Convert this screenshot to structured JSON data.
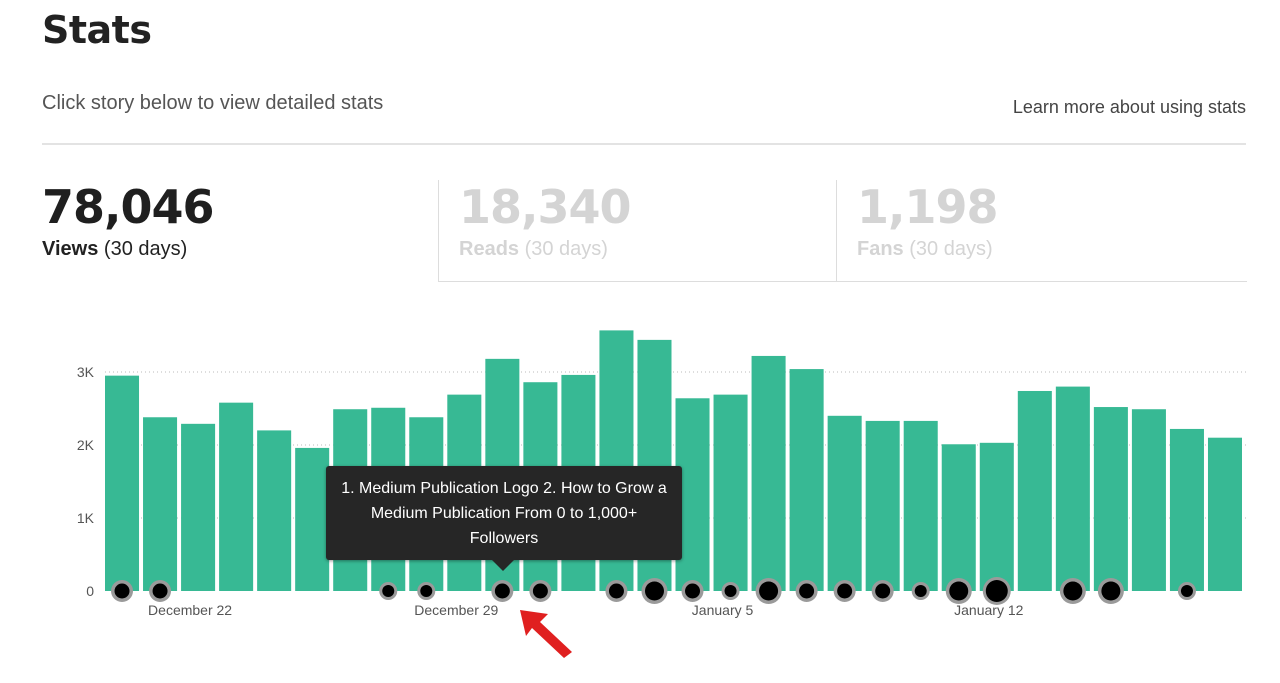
{
  "header": {
    "title": "Stats",
    "subtitle": "Click story below to view detailed stats",
    "learn_more": "Learn more about using stats"
  },
  "metrics": [
    {
      "value": "78,046",
      "label": "Views",
      "period": "(30 days)",
      "active": true
    },
    {
      "value": "18,340",
      "label": "Reads",
      "period": "(30 days)",
      "active": false
    },
    {
      "value": "1,198",
      "label": "Fans",
      "period": "(30 days)",
      "active": false
    }
  ],
  "tooltip": {
    "text": "1. Medium Publication Logo 2. How to Grow a Medium Publication From 0 to 1,000+ Followers"
  },
  "colors": {
    "bar": "#37b994",
    "tooltip_bg": "#262626",
    "arrow": "#e02020"
  },
  "chart_data": {
    "type": "bar",
    "yticks": [
      "0",
      "1K",
      "2K",
      "3K"
    ],
    "ylim": [
      0,
      3500
    ],
    "x_labels": [
      {
        "index": 2,
        "text": "December 22"
      },
      {
        "index": 9,
        "text": "December 29"
      },
      {
        "index": 16,
        "text": "January 5"
      },
      {
        "index": 23,
        "text": "January 12"
      }
    ],
    "values": [
      2950,
      2380,
      2290,
      2580,
      2200,
      1960,
      2490,
      2510,
      2380,
      2690,
      3180,
      2860,
      2960,
      3570,
      3440,
      2640,
      2690,
      3220,
      3040,
      2400,
      2330,
      2330,
      2010,
      2030,
      2740,
      2800,
      2520,
      2490,
      2220,
      2100
    ],
    "markers": [
      {
        "index": 0,
        "size": "medium"
      },
      {
        "index": 1,
        "size": "medium"
      },
      {
        "index": 7,
        "size": "small"
      },
      {
        "index": 8,
        "size": "small"
      },
      {
        "index": 10,
        "size": "medium"
      },
      {
        "index": 11,
        "size": "medium"
      },
      {
        "index": 13,
        "size": "medium"
      },
      {
        "index": 14,
        "size": "large"
      },
      {
        "index": 15,
        "size": "medium"
      },
      {
        "index": 16,
        "size": "small"
      },
      {
        "index": 17,
        "size": "large"
      },
      {
        "index": 18,
        "size": "medium"
      },
      {
        "index": 19,
        "size": "medium"
      },
      {
        "index": 20,
        "size": "medium"
      },
      {
        "index": 21,
        "size": "small"
      },
      {
        "index": 22,
        "size": "large"
      },
      {
        "index": 23,
        "size": "xlarge"
      },
      {
        "index": 25,
        "size": "large"
      },
      {
        "index": 26,
        "size": "large"
      },
      {
        "index": 28,
        "size": "small"
      }
    ],
    "grid": "dotted"
  }
}
